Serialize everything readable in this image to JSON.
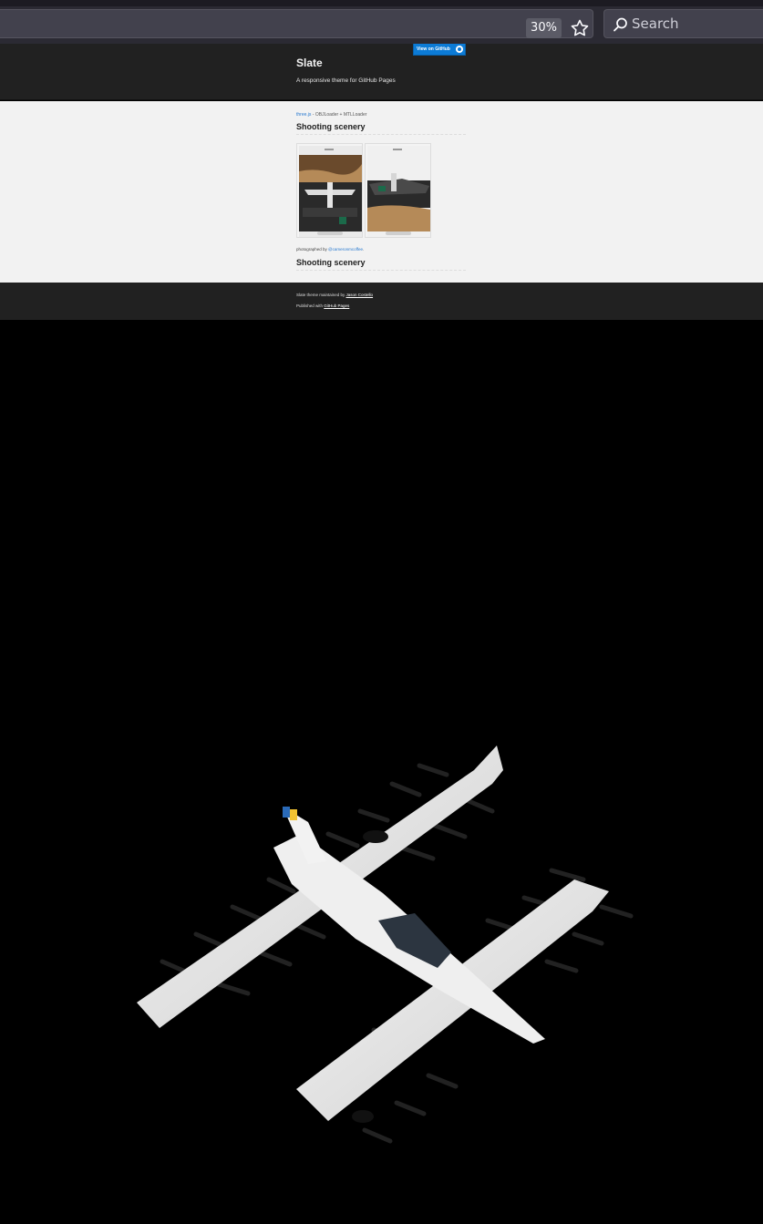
{
  "browser": {
    "zoom_level": "30%",
    "search_placeholder": "Search"
  },
  "header": {
    "title": "Slate",
    "tagline": "A responsive theme for GitHub Pages",
    "github_button_label": "View on GitHub"
  },
  "breadcrumb": {
    "link": "three.js",
    "text": " - OBJLoader + MTLLoader"
  },
  "main": {
    "heading_1": "Shooting scenery",
    "heading_2": "Shooting scenery",
    "credit_prefix": "photographed by ",
    "credit_link": "@cameronmcoffee",
    "credit_suffix": "."
  },
  "footer": {
    "line_1_prefix": "Slate theme maintained by ",
    "line_1_link": "Jason Costello",
    "line_2_prefix": "Published with ",
    "line_2_link": "GitHub Pages"
  },
  "colors": {
    "toolbar_bg": "#2b2a33",
    "header_bg": "#212121",
    "content_bg": "#f2f2f2",
    "link": "#2879d0",
    "github_button": "#0c7bd6",
    "viewer_bg": "#000000"
  },
  "icons": {
    "bookmark": "star-icon",
    "search": "search-icon",
    "github": "github-icon"
  }
}
